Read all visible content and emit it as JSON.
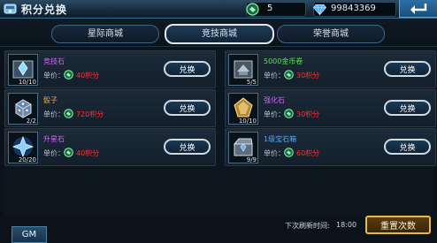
{
  "header": {
    "title": "积分兑换",
    "points_value": "5",
    "gems_value": "99843369"
  },
  "tabs": [
    {
      "label": "星际商城",
      "active": false
    },
    {
      "label": "竞技商城",
      "active": true
    },
    {
      "label": "荣誉商城",
      "active": false
    }
  ],
  "items": [
    {
      "name": "竞技石",
      "name_color": "#c86cf0",
      "count": "10/10",
      "price_label": "单价：",
      "price": "40积分",
      "button": "兑换",
      "icon": "crystal-box-icon"
    },
    {
      "name": "5000金币卷",
      "name_color": "#5ee04d",
      "count": "5/5",
      "price_label": "单价：",
      "price": "30积分",
      "button": "兑换",
      "icon": "gold-coupon-icon"
    },
    {
      "name": "骰子",
      "name_color": "#f0a52a",
      "count": "2/2",
      "price_label": "单价：",
      "price": "720积分",
      "button": "兑换",
      "icon": "dice-icon"
    },
    {
      "name": "强化石",
      "name_color": "#c86cf0",
      "count": "10/10",
      "price_label": "单价：",
      "price": "30积分",
      "button": "兑换",
      "icon": "enhance-stone-icon"
    },
    {
      "name": "升星石",
      "name_color": "#c86cf0",
      "count": "20/20",
      "price_label": "单价：",
      "price": "40积分",
      "button": "兑换",
      "icon": "star-stone-icon"
    },
    {
      "name": "1级宝石箱",
      "name_color": "#59a6f5",
      "count": "9/9",
      "price_label": "单价：",
      "price": "60积分",
      "button": "兑换",
      "icon": "gem-chest-icon"
    }
  ],
  "footer": {
    "gm_label": "GM",
    "refresh_label": "下次刷新时间:",
    "refresh_time": "18:00",
    "reset_label": "重置次数"
  },
  "colors": {
    "accent": "#3d6f8f",
    "price_red": "#ff2e2e",
    "point_green": "#3fd07a",
    "gem_blue": "#5bb5ff",
    "reset_gold": "#e7b94a"
  }
}
